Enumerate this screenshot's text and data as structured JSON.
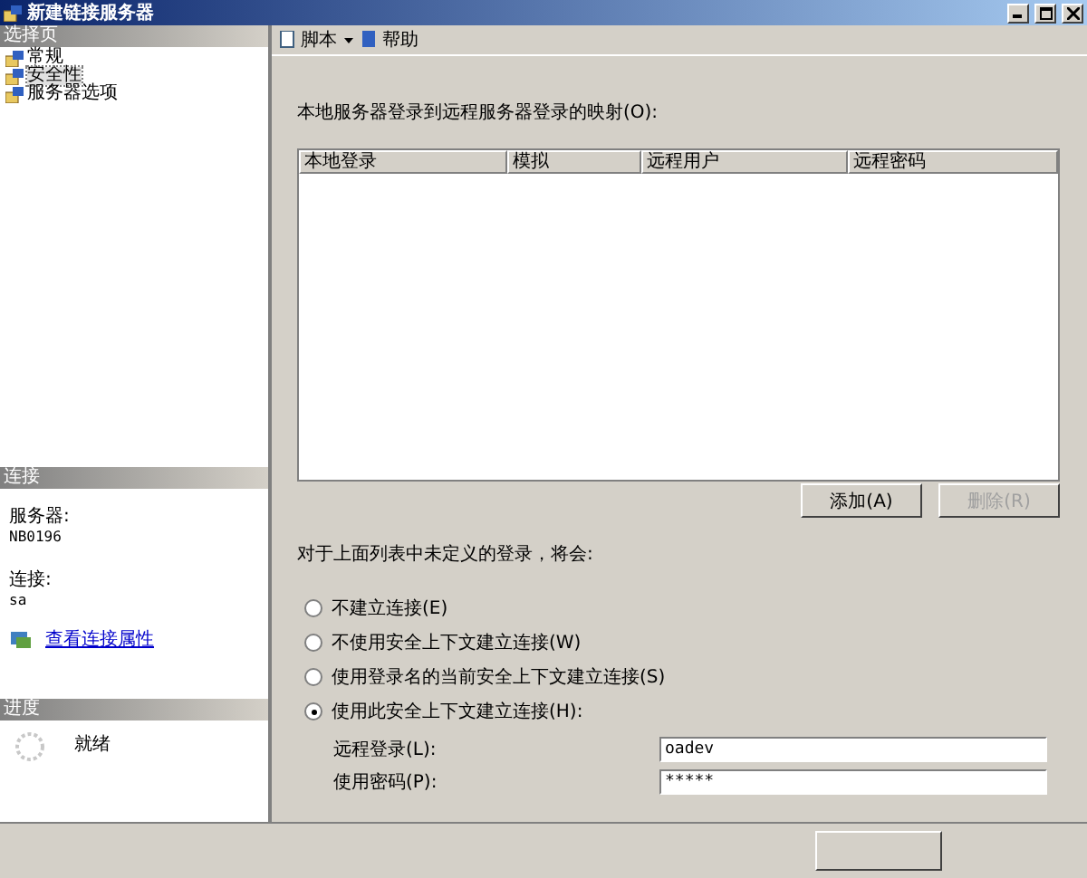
{
  "window": {
    "title": "新建链接服务器"
  },
  "sidebar": {
    "header": "选择页",
    "items": [
      {
        "label": "常规",
        "selected": false
      },
      {
        "label": "安全性",
        "selected": true
      },
      {
        "label": "服务器选项",
        "selected": false
      }
    ]
  },
  "connection": {
    "header": "连接",
    "server_label": "服务器:",
    "server": "NB0196",
    "connection_label": "连接:",
    "connection": "sa",
    "link": "查看连接属性"
  },
  "progress": {
    "header": "进度",
    "status": "就绪"
  },
  "toolbar": {
    "items": [
      "脚本",
      "帮助"
    ]
  },
  "mapping": {
    "label": "本地服务器登录到远程服务器登录的映射(O):",
    "columns": [
      "本地登录",
      "模拟",
      "远程用户",
      "远程密码"
    ],
    "buttons": [
      {
        "label": "添加(A)",
        "disabled": false
      },
      {
        "label": "删除(R)",
        "disabled": true
      }
    ]
  },
  "undefined_logins": {
    "label": "对于上面列表中未定义的登录，将会:",
    "options": [
      {
        "label": "不建立连接(E)",
        "selected": false
      },
      {
        "label": "不使用安全上下文建立连接(W)",
        "selected": false
      },
      {
        "label": "使用登录名的当前安全上下文建立连接(S)",
        "selected": false
      },
      {
        "label": "使用此安全上下文建立连接(H):",
        "selected": true
      }
    ],
    "fields": [
      {
        "label": "远程登录(L):",
        "value": "oadev"
      },
      {
        "label": "使用密码(P):",
        "value": "*****"
      }
    ]
  }
}
